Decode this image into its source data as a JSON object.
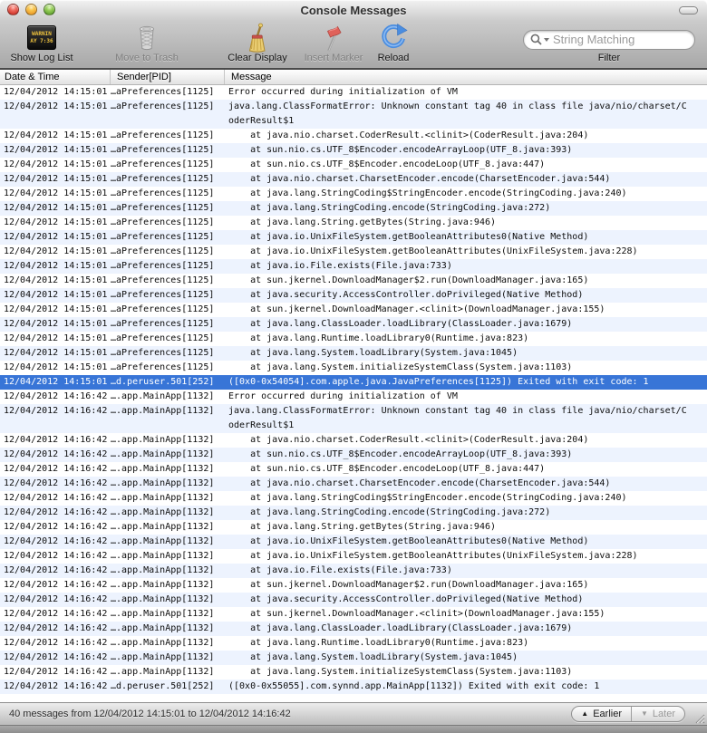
{
  "window": {
    "title": "Console Messages"
  },
  "colors": {
    "selection": "#3875d7",
    "alt_row": "#edf3fe",
    "flag_red": "#e0615a",
    "reload_blue": "#4a8de0"
  },
  "toolbar": {
    "items": [
      {
        "label": "Show Log List",
        "enabled": true,
        "icon_text_line1": "WARNIN",
        "icon_text_line2": "AY 7:36"
      },
      {
        "label": "Move to Trash",
        "enabled": false
      },
      {
        "label": "Clear Display",
        "enabled": true
      },
      {
        "label": "Insert Marker",
        "enabled": false
      },
      {
        "label": "Reload",
        "enabled": true
      }
    ],
    "filter": {
      "placeholder": "String Matching",
      "label": "Filter"
    }
  },
  "table": {
    "columns": [
      "Date & Time",
      "Sender[PID]",
      "Message"
    ],
    "rows": [
      {
        "date": "12/04/2012 14:15:01",
        "sender": "…aPreferences[1125]",
        "message": "Error occurred during initialization of VM"
      },
      {
        "date": "12/04/2012 14:15:01",
        "sender": "…aPreferences[1125]",
        "message": "java.lang.ClassFormatError: Unknown constant tag 40 in class file java/nio/charset/CoderResult$1"
      },
      {
        "date": "12/04/2012 14:15:01",
        "sender": "…aPreferences[1125]",
        "message": "    at java.nio.charset.CoderResult.<clinit>(CoderResult.java:204)"
      },
      {
        "date": "12/04/2012 14:15:01",
        "sender": "…aPreferences[1125]",
        "message": "    at sun.nio.cs.UTF_8$Encoder.encodeArrayLoop(UTF_8.java:393)"
      },
      {
        "date": "12/04/2012 14:15:01",
        "sender": "…aPreferences[1125]",
        "message": "    at sun.nio.cs.UTF_8$Encoder.encodeLoop(UTF_8.java:447)"
      },
      {
        "date": "12/04/2012 14:15:01",
        "sender": "…aPreferences[1125]",
        "message": "    at java.nio.charset.CharsetEncoder.encode(CharsetEncoder.java:544)"
      },
      {
        "date": "12/04/2012 14:15:01",
        "sender": "…aPreferences[1125]",
        "message": "    at java.lang.StringCoding$StringEncoder.encode(StringCoding.java:240)"
      },
      {
        "date": "12/04/2012 14:15:01",
        "sender": "…aPreferences[1125]",
        "message": "    at java.lang.StringCoding.encode(StringCoding.java:272)"
      },
      {
        "date": "12/04/2012 14:15:01",
        "sender": "…aPreferences[1125]",
        "message": "    at java.lang.String.getBytes(String.java:946)"
      },
      {
        "date": "12/04/2012 14:15:01",
        "sender": "…aPreferences[1125]",
        "message": "    at java.io.UnixFileSystem.getBooleanAttributes0(Native Method)"
      },
      {
        "date": "12/04/2012 14:15:01",
        "sender": "…aPreferences[1125]",
        "message": "    at java.io.UnixFileSystem.getBooleanAttributes(UnixFileSystem.java:228)"
      },
      {
        "date": "12/04/2012 14:15:01",
        "sender": "…aPreferences[1125]",
        "message": "    at java.io.File.exists(File.java:733)"
      },
      {
        "date": "12/04/2012 14:15:01",
        "sender": "…aPreferences[1125]",
        "message": "    at sun.jkernel.DownloadManager$2.run(DownloadManager.java:165)"
      },
      {
        "date": "12/04/2012 14:15:01",
        "sender": "…aPreferences[1125]",
        "message": "    at java.security.AccessController.doPrivileged(Native Method)"
      },
      {
        "date": "12/04/2012 14:15:01",
        "sender": "…aPreferences[1125]",
        "message": "    at sun.jkernel.DownloadManager.<clinit>(DownloadManager.java:155)"
      },
      {
        "date": "12/04/2012 14:15:01",
        "sender": "…aPreferences[1125]",
        "message": "    at java.lang.ClassLoader.loadLibrary(ClassLoader.java:1679)"
      },
      {
        "date": "12/04/2012 14:15:01",
        "sender": "…aPreferences[1125]",
        "message": "    at java.lang.Runtime.loadLibrary0(Runtime.java:823)"
      },
      {
        "date": "12/04/2012 14:15:01",
        "sender": "…aPreferences[1125]",
        "message": "    at java.lang.System.loadLibrary(System.java:1045)"
      },
      {
        "date": "12/04/2012 14:15:01",
        "sender": "…aPreferences[1125]",
        "message": "    at java.lang.System.initializeSystemClass(System.java:1103)"
      },
      {
        "date": "12/04/2012 14:15:01",
        "sender": "…d.peruser.501[252]",
        "message": "([0x0-0x54054].com.apple.java.JavaPreferences[1125]) Exited with exit code: 1",
        "selected": true
      },
      {
        "date": "12/04/2012 14:16:42",
        "sender": "….app.MainApp[1132]",
        "message": "Error occurred during initialization of VM"
      },
      {
        "date": "12/04/2012 14:16:42",
        "sender": "….app.MainApp[1132]",
        "message": "java.lang.ClassFormatError: Unknown constant tag 40 in class file java/nio/charset/CoderResult$1"
      },
      {
        "date": "12/04/2012 14:16:42",
        "sender": "….app.MainApp[1132]",
        "message": "    at java.nio.charset.CoderResult.<clinit>(CoderResult.java:204)"
      },
      {
        "date": "12/04/2012 14:16:42",
        "sender": "….app.MainApp[1132]",
        "message": "    at sun.nio.cs.UTF_8$Encoder.encodeArrayLoop(UTF_8.java:393)"
      },
      {
        "date": "12/04/2012 14:16:42",
        "sender": "….app.MainApp[1132]",
        "message": "    at sun.nio.cs.UTF_8$Encoder.encodeLoop(UTF_8.java:447)"
      },
      {
        "date": "12/04/2012 14:16:42",
        "sender": "….app.MainApp[1132]",
        "message": "    at java.nio.charset.CharsetEncoder.encode(CharsetEncoder.java:544)"
      },
      {
        "date": "12/04/2012 14:16:42",
        "sender": "….app.MainApp[1132]",
        "message": "    at java.lang.StringCoding$StringEncoder.encode(StringCoding.java:240)"
      },
      {
        "date": "12/04/2012 14:16:42",
        "sender": "….app.MainApp[1132]",
        "message": "    at java.lang.StringCoding.encode(StringCoding.java:272)"
      },
      {
        "date": "12/04/2012 14:16:42",
        "sender": "….app.MainApp[1132]",
        "message": "    at java.lang.String.getBytes(String.java:946)"
      },
      {
        "date": "12/04/2012 14:16:42",
        "sender": "….app.MainApp[1132]",
        "message": "    at java.io.UnixFileSystem.getBooleanAttributes0(Native Method)"
      },
      {
        "date": "12/04/2012 14:16:42",
        "sender": "….app.MainApp[1132]",
        "message": "    at java.io.UnixFileSystem.getBooleanAttributes(UnixFileSystem.java:228)"
      },
      {
        "date": "12/04/2012 14:16:42",
        "sender": "….app.MainApp[1132]",
        "message": "    at java.io.File.exists(File.java:733)"
      },
      {
        "date": "12/04/2012 14:16:42",
        "sender": "….app.MainApp[1132]",
        "message": "    at sun.jkernel.DownloadManager$2.run(DownloadManager.java:165)"
      },
      {
        "date": "12/04/2012 14:16:42",
        "sender": "….app.MainApp[1132]",
        "message": "    at java.security.AccessController.doPrivileged(Native Method)"
      },
      {
        "date": "12/04/2012 14:16:42",
        "sender": "….app.MainApp[1132]",
        "message": "    at sun.jkernel.DownloadManager.<clinit>(DownloadManager.java:155)"
      },
      {
        "date": "12/04/2012 14:16:42",
        "sender": "….app.MainApp[1132]",
        "message": "    at java.lang.ClassLoader.loadLibrary(ClassLoader.java:1679)"
      },
      {
        "date": "12/04/2012 14:16:42",
        "sender": "….app.MainApp[1132]",
        "message": "    at java.lang.Runtime.loadLibrary0(Runtime.java:823)"
      },
      {
        "date": "12/04/2012 14:16:42",
        "sender": "….app.MainApp[1132]",
        "message": "    at java.lang.System.loadLibrary(System.java:1045)"
      },
      {
        "date": "12/04/2012 14:16:42",
        "sender": "….app.MainApp[1132]",
        "message": "    at java.lang.System.initializeSystemClass(System.java:1103)"
      },
      {
        "date": "12/04/2012 14:16:42",
        "sender": "…d.peruser.501[252]",
        "message": "([0x0-0x55055].com.synnd.app.MainApp[1132]) Exited with exit code: 1"
      }
    ]
  },
  "statusbar": {
    "summary": "40 messages from 12/04/2012 14:15:01 to 12/04/2012 14:16:42",
    "earlier_label": "Earlier",
    "later_label": "Later"
  }
}
